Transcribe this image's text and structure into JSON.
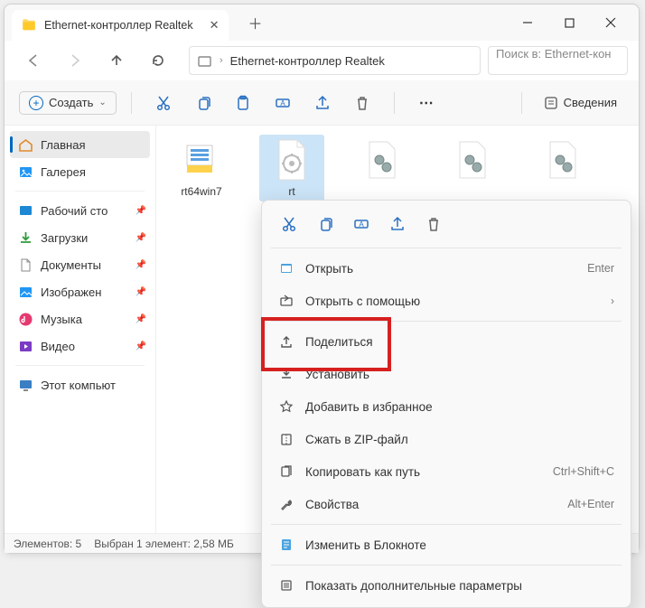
{
  "titlebar": {
    "tab_title": "Ethernet-контроллер Realtek"
  },
  "addressbar": {
    "path": "Ethernet-контроллер Realtek",
    "search_placeholder": "Поиск в: Ethernet-кон"
  },
  "toolbar": {
    "create_label": "Создать",
    "details_label": "Сведения"
  },
  "sidebar": {
    "home": "Главная",
    "gallery": "Галерея",
    "desktop": "Рабочий сто",
    "downloads": "Загрузки",
    "documents": "Документы",
    "pictures": "Изображен",
    "music": "Музыка",
    "video": "Видео",
    "thispc": "Этот компьют"
  },
  "files": {
    "f0": "rt64win7",
    "f1": "rt",
    "f2": "",
    "f3": "",
    "f4": ""
  },
  "statusbar": {
    "count": "Элементов: 5",
    "selected": "Выбран 1 элемент: 2,58 МБ"
  },
  "ctx": {
    "open": "Открыть",
    "openwith": "Открыть с помощью",
    "share": "Поделиться",
    "install": "Установить",
    "favorite": "Добавить в избранное",
    "zip": "Сжать в ZIP-файл",
    "copypath": "Копировать как путь",
    "properties": "Свойства",
    "notepad": "Изменить в Блокноте",
    "more": "Показать дополнительные параметры",
    "sc_open": "Enter",
    "sc_copypath": "Ctrl+Shift+C",
    "sc_props": "Alt+Enter"
  }
}
